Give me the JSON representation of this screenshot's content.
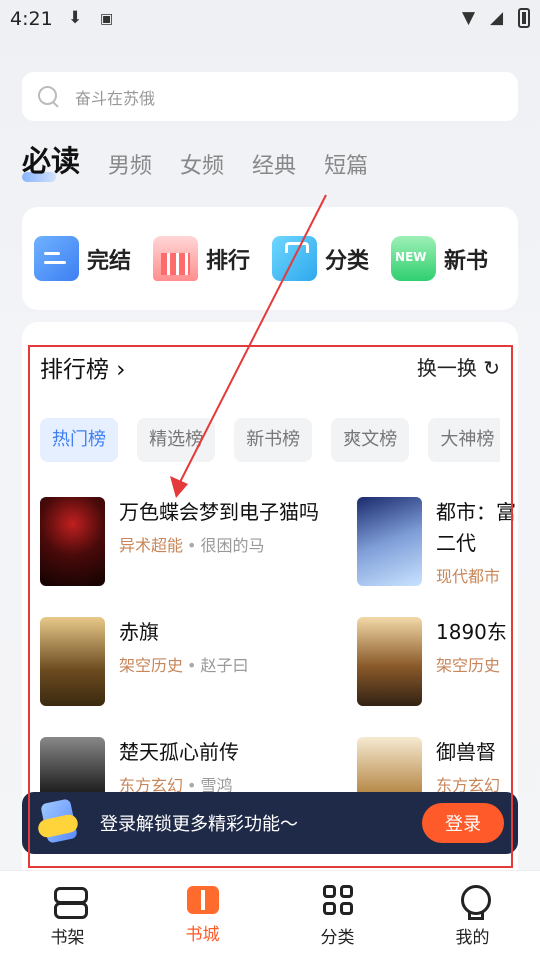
{
  "status": {
    "time": "4:21"
  },
  "search": {
    "placeholder": "奋斗在苏俄"
  },
  "tabs": [
    "必读",
    "男频",
    "女频",
    "经典",
    "短篇"
  ],
  "quick": [
    "完结",
    "排行",
    "分类",
    "新书"
  ],
  "quick_new_badge": "NEW",
  "ranking": {
    "title": "排行榜 ›",
    "refresh": "换一换 ↻",
    "pills": [
      "热门榜",
      "精选榜",
      "新书榜",
      "爽文榜",
      "大神榜"
    ],
    "books_left": [
      {
        "title": "万色蝶会梦到电子猫吗",
        "tag": "异术超能",
        "author": "很困的马"
      },
      {
        "title": "赤旗",
        "tag": "架空历史",
        "author": "赵子曰"
      },
      {
        "title": "楚天孤心前传",
        "tag": "东方玄幻",
        "author": "雪鸿"
      }
    ],
    "books_right": [
      {
        "title": "都市：富二代",
        "tag": "现代都市"
      },
      {
        "title": "1890东",
        "tag": "架空历史"
      },
      {
        "title": "御兽督",
        "tag": "东方玄幻"
      }
    ]
  },
  "login": {
    "text": "登录解锁更多精彩功能～",
    "button": "登录"
  },
  "nav": [
    "书架",
    "书城",
    "分类",
    "我的"
  ]
}
